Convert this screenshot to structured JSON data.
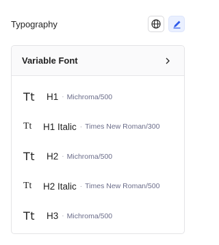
{
  "header": {
    "title": "Typography",
    "icons": [
      "globe-icon",
      "pencil-icon"
    ],
    "accent": "#2f5bea"
  },
  "card": {
    "title": "Variable Font",
    "chevron": "›"
  },
  "styles": [
    {
      "glyph": "Tt",
      "name": "H1",
      "separator": "·",
      "font": "Michroma/500"
    },
    {
      "glyph": "Tt",
      "name": "H1 Italic",
      "separator": "·",
      "font": "Times New Roman/300"
    },
    {
      "glyph": "Tt",
      "name": "H2",
      "separator": "·",
      "font": "Michroma/500"
    },
    {
      "glyph": "Tt",
      "name": "H2 Italic",
      "separator": "·",
      "font": "Times New Roman/500"
    },
    {
      "glyph": "Tt",
      "name": "H3",
      "separator": "·",
      "font": "Michroma/500"
    }
  ]
}
